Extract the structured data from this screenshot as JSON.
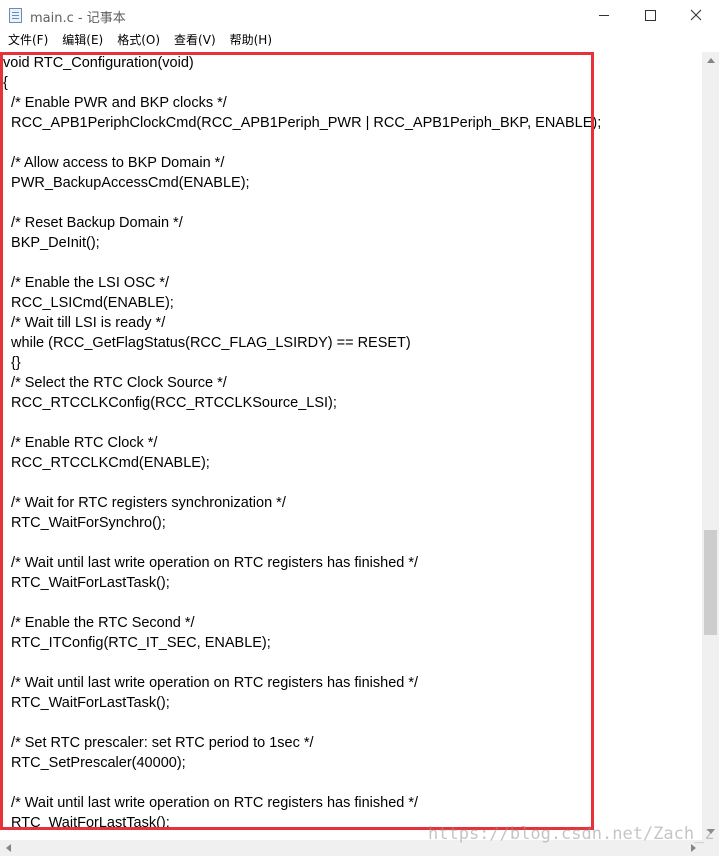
{
  "window": {
    "title": "main.c - 记事本",
    "icon": "notepad-icon"
  },
  "menu": {
    "items": [
      {
        "label": "文件(F)"
      },
      {
        "label": "编辑(E)"
      },
      {
        "label": "格式(O)"
      },
      {
        "label": "查看(V)"
      },
      {
        "label": "帮助(H)"
      }
    ]
  },
  "code": {
    "lines": [
      "void RTC_Configuration(void)",
      "{",
      "  /* Enable PWR and BKP clocks */",
      "  RCC_APB1PeriphClockCmd(RCC_APB1Periph_PWR | RCC_APB1Periph_BKP, ENABLE);",
      "",
      "  /* Allow access to BKP Domain */",
      "  PWR_BackupAccessCmd(ENABLE);",
      "",
      "  /* Reset Backup Domain */",
      "  BKP_DeInit();",
      "",
      "  /* Enable the LSI OSC */",
      "  RCC_LSICmd(ENABLE);",
      "  /* Wait till LSI is ready */",
      "  while (RCC_GetFlagStatus(RCC_FLAG_LSIRDY) == RESET)",
      "  {}",
      "  /* Select the RTC Clock Source */",
      "  RCC_RTCCLKConfig(RCC_RTCCLKSource_LSI);",
      "",
      "  /* Enable RTC Clock */",
      "  RCC_RTCCLKCmd(ENABLE);",
      "",
      "  /* Wait for RTC registers synchronization */",
      "  RTC_WaitForSynchro();",
      "",
      "  /* Wait until last write operation on RTC registers has finished */",
      "  RTC_WaitForLastTask();",
      "",
      "  /* Enable the RTC Second */",
      "  RTC_ITConfig(RTC_IT_SEC, ENABLE);",
      "",
      "  /* Wait until last write operation on RTC registers has finished */",
      "  RTC_WaitForLastTask();",
      "",
      "  /* Set RTC prescaler: set RTC period to 1sec */",
      "  RTC_SetPrescaler(40000);",
      "",
      "  /* Wait until last write operation on RTC registers has finished */",
      "  RTC_WaitForLastTask();"
    ]
  },
  "watermark": "https://blog.csdn.net/Zach_z",
  "colors": {
    "highlight_border": "#e8323a"
  }
}
